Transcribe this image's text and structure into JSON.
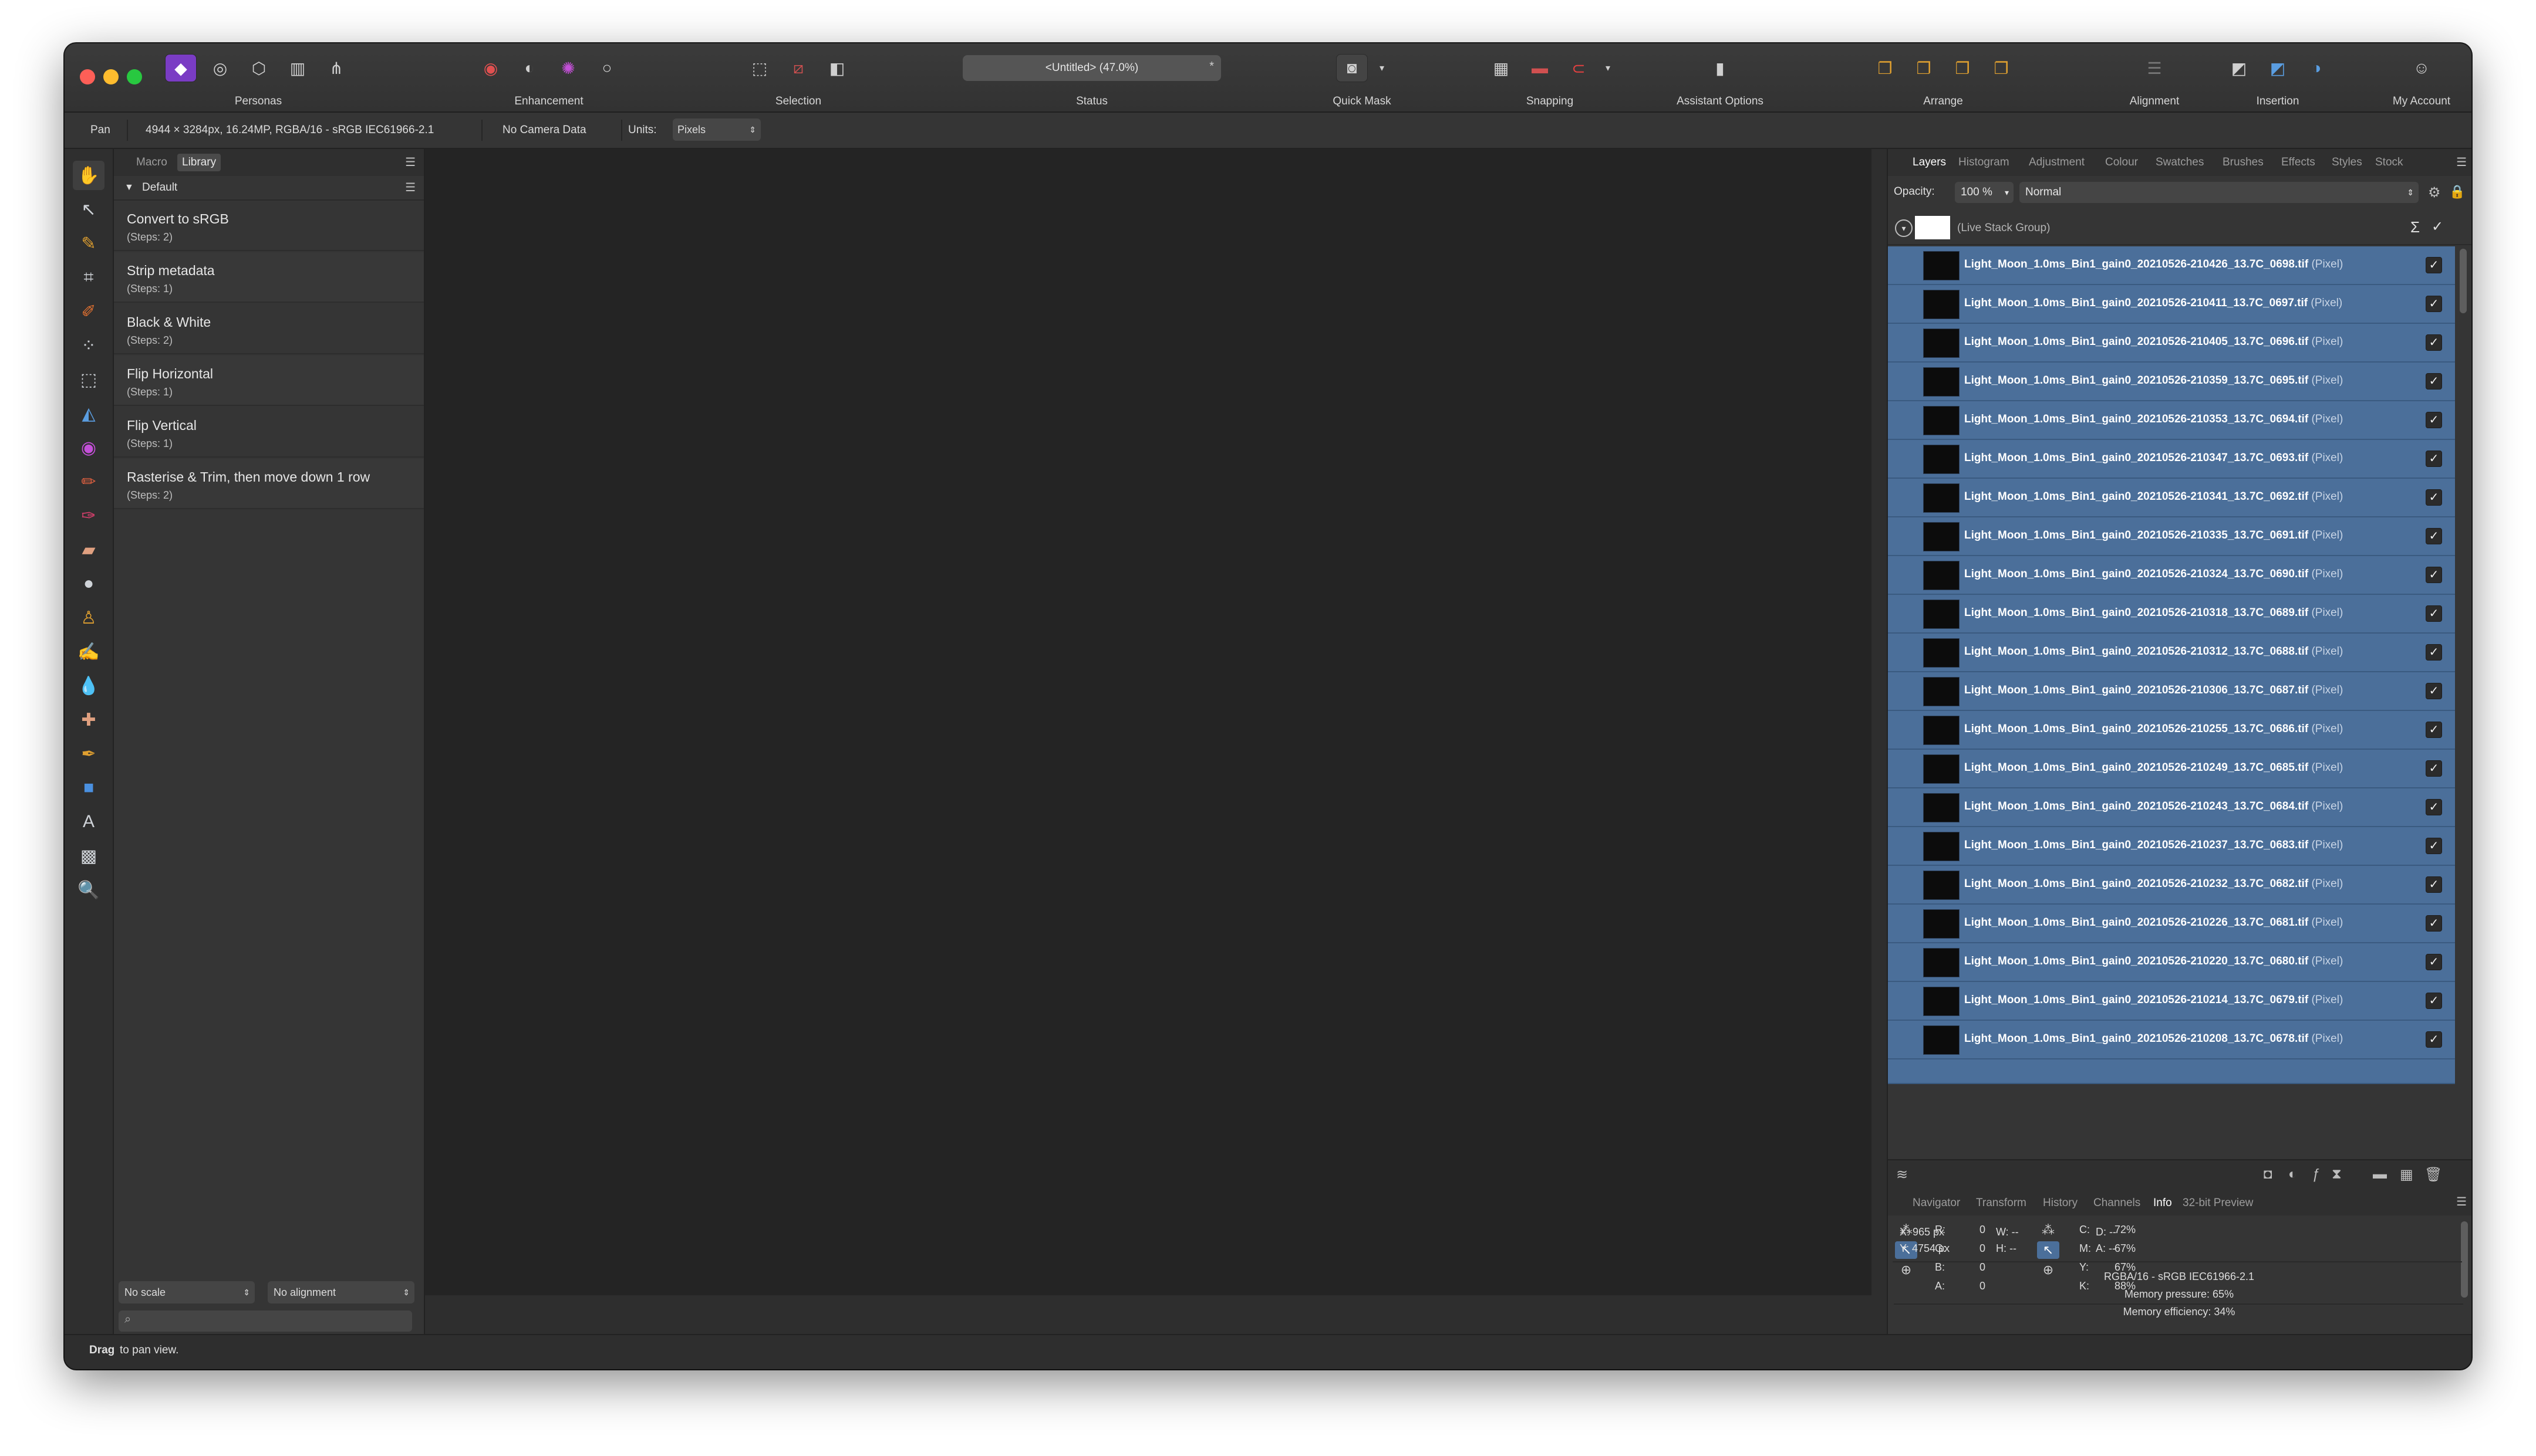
{
  "toolbar": {
    "personas_label": "Personas",
    "enhancement_label": "Enhancement",
    "selection_label": "Selection",
    "status_label": "Status",
    "document_title": "<Untitled> (47.0%)",
    "document_modified": "*",
    "quickmask_label": "Quick Mask",
    "snapping_label": "Snapping",
    "assistant_label": "Assistant Options",
    "arrange_label": "Arrange",
    "alignment_label": "Alignment",
    "insertion_label": "Insertion",
    "account_label": "My Account"
  },
  "context_bar": {
    "tool": "Pan",
    "doc_info": "4944 × 3284px, 16.24MP, RGBA/16 - sRGB IEC61966-2.1",
    "camera": "No Camera Data",
    "units_label": "Units:",
    "units_value": "Pixels"
  },
  "library": {
    "tabs": [
      "Macro",
      "Library"
    ],
    "active_tab": "Library",
    "category": "Default",
    "macros": [
      {
        "name": "Convert to sRGB",
        "steps": "(Steps: 2)"
      },
      {
        "name": "Strip metadata",
        "steps": "(Steps: 1)"
      },
      {
        "name": "Black & White",
        "steps": "(Steps: 2)"
      },
      {
        "name": "Flip Horizontal",
        "steps": "(Steps: 1)"
      },
      {
        "name": "Flip Vertical",
        "steps": "(Steps: 1)"
      },
      {
        "name": "Rasterise & Trim, then move down 1 row",
        "steps": "(Steps: 2)"
      }
    ],
    "scale_value": "No scale",
    "alignment_value": "No alignment"
  },
  "layers_panel": {
    "tabs": [
      "Layers",
      "Histogram",
      "Adjustment",
      "Colour",
      "Swatches",
      "Brushes",
      "Effects",
      "Styles",
      "Stock"
    ],
    "active_tab": "Layers",
    "opacity_label": "Opacity:",
    "opacity_value": "100 %",
    "blend_mode": "Normal",
    "group_name": "(Live Stack Group)",
    "sigma_symbol": "Σ",
    "layer_kind": "(Pixel)",
    "layers": [
      "Light_Moon_1.0ms_Bin1_gain0_20210526-210426_13.7C_0698.tif",
      "Light_Moon_1.0ms_Bin1_gain0_20210526-210411_13.7C_0697.tif",
      "Light_Moon_1.0ms_Bin1_gain0_20210526-210405_13.7C_0696.tif",
      "Light_Moon_1.0ms_Bin1_gain0_20210526-210359_13.7C_0695.tif",
      "Light_Moon_1.0ms_Bin1_gain0_20210526-210353_13.7C_0694.tif",
      "Light_Moon_1.0ms_Bin1_gain0_20210526-210347_13.7C_0693.tif",
      "Light_Moon_1.0ms_Bin1_gain0_20210526-210341_13.7C_0692.tif",
      "Light_Moon_1.0ms_Bin1_gain0_20210526-210335_13.7C_0691.tif",
      "Light_Moon_1.0ms_Bin1_gain0_20210526-210324_13.7C_0690.tif",
      "Light_Moon_1.0ms_Bin1_gain0_20210526-210318_13.7C_0689.tif",
      "Light_Moon_1.0ms_Bin1_gain0_20210526-210312_13.7C_0688.tif",
      "Light_Moon_1.0ms_Bin1_gain0_20210526-210306_13.7C_0687.tif",
      "Light_Moon_1.0ms_Bin1_gain0_20210526-210255_13.7C_0686.tif",
      "Light_Moon_1.0ms_Bin1_gain0_20210526-210249_13.7C_0685.tif",
      "Light_Moon_1.0ms_Bin1_gain0_20210526-210243_13.7C_0684.tif",
      "Light_Moon_1.0ms_Bin1_gain0_20210526-210237_13.7C_0683.tif",
      "Light_Moon_1.0ms_Bin1_gain0_20210526-210232_13.7C_0682.tif",
      "Light_Moon_1.0ms_Bin1_gain0_20210526-210226_13.7C_0681.tif",
      "Light_Moon_1.0ms_Bin1_gain0_20210526-210220_13.7C_0680.tif",
      "Light_Moon_1.0ms_Bin1_gain0_20210526-210214_13.7C_0679.tif",
      "Light_Moon_1.0ms_Bin1_gain0_20210526-210208_13.7C_0678.tif"
    ]
  },
  "info_panel": {
    "tabs": [
      "Navigator",
      "Transform",
      "History",
      "Channels",
      "Info",
      "32-bit Preview"
    ],
    "active_tab": "Info",
    "rgba": [
      {
        "label": "R:",
        "value": "0"
      },
      {
        "label": "G:",
        "value": "0"
      },
      {
        "label": "B:",
        "value": "0"
      },
      {
        "label": "A:",
        "value": "0"
      }
    ],
    "cmyk": [
      {
        "label": "C:",
        "value": "72%"
      },
      {
        "label": "M:",
        "value": "67%"
      },
      {
        "label": "Y:",
        "value": "67%"
      },
      {
        "label": "K:",
        "value": "88%"
      }
    ],
    "x_pos": "X: 965 px",
    "y_pos": "Y: 4754 px",
    "w": "W: --",
    "h": "H: --",
    "d": "D: --",
    "a": "A: --",
    "color_profile": "RGBA/16 - sRGB IEC61966-2.1",
    "memory_pressure": "Memory pressure: 65%",
    "memory_efficiency": "Memory efficiency: 34%"
  },
  "statusbar": {
    "bold": "Drag",
    "text": " to pan view."
  },
  "colors": {
    "selection_blue": "#4b6f9a",
    "canvas": "#242424",
    "panel": "#353535"
  },
  "icons": {
    "personas": [
      "photo-persona-icon",
      "liquify-persona-icon",
      "develop-persona-icon",
      "tone-map-persona-icon",
      "export-persona-icon"
    ],
    "enhancement": [
      "levels-icon",
      "black-white-icon",
      "hsl-icon",
      "white-balance-icon"
    ]
  }
}
